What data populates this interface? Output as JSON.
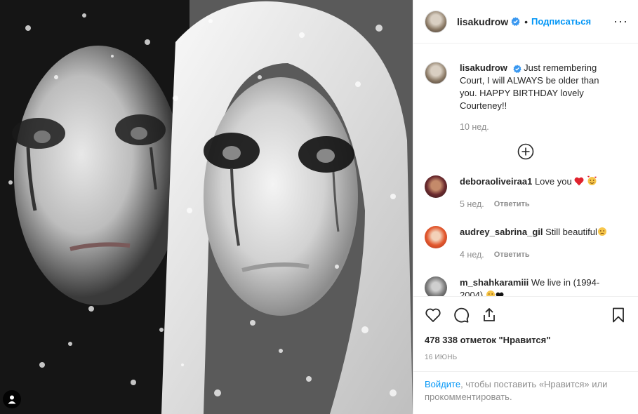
{
  "header": {
    "username": "lisakudrow",
    "follow_label": "Подписаться",
    "separator": "•"
  },
  "caption": {
    "username": "lisakudrow",
    "text": "Just remembering Court, I will ALWAYS be older than you. HAPPY BIRTHDAY lovely Courteney!!",
    "time": "10 нед."
  },
  "comments": [
    {
      "username": "deboraoliveiraa1",
      "text": "Love you",
      "time": "5 нед.",
      "reply": "Ответить",
      "emojis": [
        "red-heart",
        "smiling-face-hearts"
      ]
    },
    {
      "username": "audrey_sabrina_gil",
      "text": "Still beautiful",
      "time": "4 нед.",
      "reply": "Ответить",
      "emojis": [
        "sad-face"
      ]
    },
    {
      "username": "m_shahkaramiii",
      "text": "We live in (1994-2004)",
      "emojis": [
        "sad-face",
        "black-heart"
      ]
    }
  ],
  "likes": "478 338 отметок \"Нравится\"",
  "date": "16 июнь",
  "login": {
    "link": "Войдите",
    "rest": ", чтобы поставить «Нравится» или прокомментировать."
  },
  "icons": {
    "verified": "verified-badge-icon",
    "more": "more-options-icon",
    "load_more": "plus-circle-icon",
    "like": "heart-outline-icon",
    "comment": "speech-bubble-icon",
    "share": "share-icon",
    "save": "bookmark-icon",
    "user_tag": "user-tag-icon"
  },
  "colors": {
    "accent": "#0095f6",
    "text": "#262626",
    "muted": "#8e8e8e",
    "border": "#efefef"
  }
}
